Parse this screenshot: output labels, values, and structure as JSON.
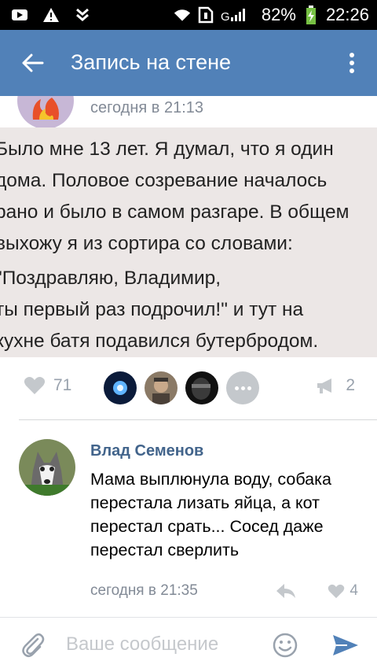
{
  "status_bar": {
    "battery_pct": "82%",
    "time": "22:26",
    "icons": [
      "video-icon",
      "warning-icon",
      "download-icon",
      "wifi-icon",
      "sim-icon",
      "signal-icon",
      "battery-charging-icon"
    ]
  },
  "header": {
    "title": "Запись на стене",
    "back_icon": "arrow-back-icon",
    "menu_icon": "more-vertical-icon"
  },
  "post": {
    "time": "сегодня в 21:13",
    "image_text_lines": [
      "Было мне 13 лет. Я думал, что я один",
      "дома. Половое созревание началось",
      "рано и было в самом разгаре. В общем",
      "выхожу я из сортира со словами:",
      "\"Поздравляю, Владимир,",
      "ты первый раз подрочил!\" и тут на",
      "кухне батя подавился бутербродом."
    ],
    "likes": "71",
    "shares": "2"
  },
  "comment": {
    "author": "Влад Семенов",
    "text": "Мама выплюнула воду, собака перестала лизать яйца, а кот перестал срать... Сосед даже перестал сверлить",
    "time": "сегодня в 21:35",
    "likes": "4"
  },
  "composer": {
    "placeholder": "Ваше сообщение"
  },
  "colors": {
    "accent": "#5181b8",
    "link": "#42648b",
    "muted": "#828a96"
  }
}
